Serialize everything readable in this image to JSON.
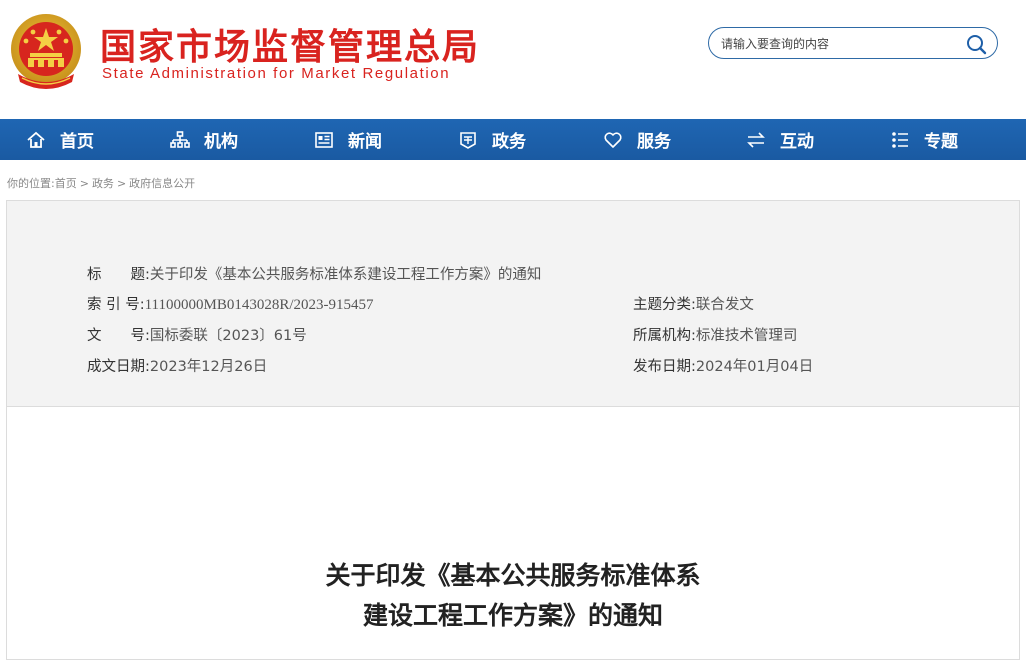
{
  "header": {
    "emblem_icon": "national-emblem",
    "title": "国家市场监督管理总局",
    "subtitle": "State Administration for Market Regulation",
    "search": {
      "placeholder": "请输入要查询的内容",
      "icon": "search-icon"
    }
  },
  "nav": {
    "items": [
      {
        "label": "首页",
        "icon": "home-icon"
      },
      {
        "label": "机构",
        "icon": "organization-icon"
      },
      {
        "label": "新闻",
        "icon": "news-icon"
      },
      {
        "label": "政务",
        "icon": "government-icon"
      },
      {
        "label": "服务",
        "icon": "heart-icon"
      },
      {
        "label": "互动",
        "icon": "exchange-icon"
      },
      {
        "label": "专题",
        "icon": "topics-icon"
      }
    ]
  },
  "breadcrumb": {
    "prefix": "你的位置:",
    "items": [
      "首页",
      "政务",
      "政府信息公开"
    ],
    "separator": ">"
  },
  "meta": {
    "title_label": "标　　题:",
    "title_value": "关于印发《基本公共服务标准体系建设工程工作方案》的通知",
    "index_label": "索 引 号:",
    "index_value": "11100000MB0143028R/2023-915457",
    "category_label": "主题分类:",
    "category_value": "联合发文",
    "docno_label": "文　　号:",
    "docno_value": "国标委联〔2023〕61号",
    "org_label": "所属机构:",
    "org_value": "标准技术管理司",
    "created_label": "成文日期:",
    "created_value": "2023年12月26日",
    "published_label": "发布日期:",
    "published_value": "2024年01月04日"
  },
  "document": {
    "title_line1": "关于印发《基本公共服务标准体系",
    "title_line2": "建设工程工作方案》的通知"
  },
  "colors": {
    "brand_red": "#d9231f",
    "nav_blue": "#1f66b3",
    "meta_bg": "#f3f3f3"
  }
}
